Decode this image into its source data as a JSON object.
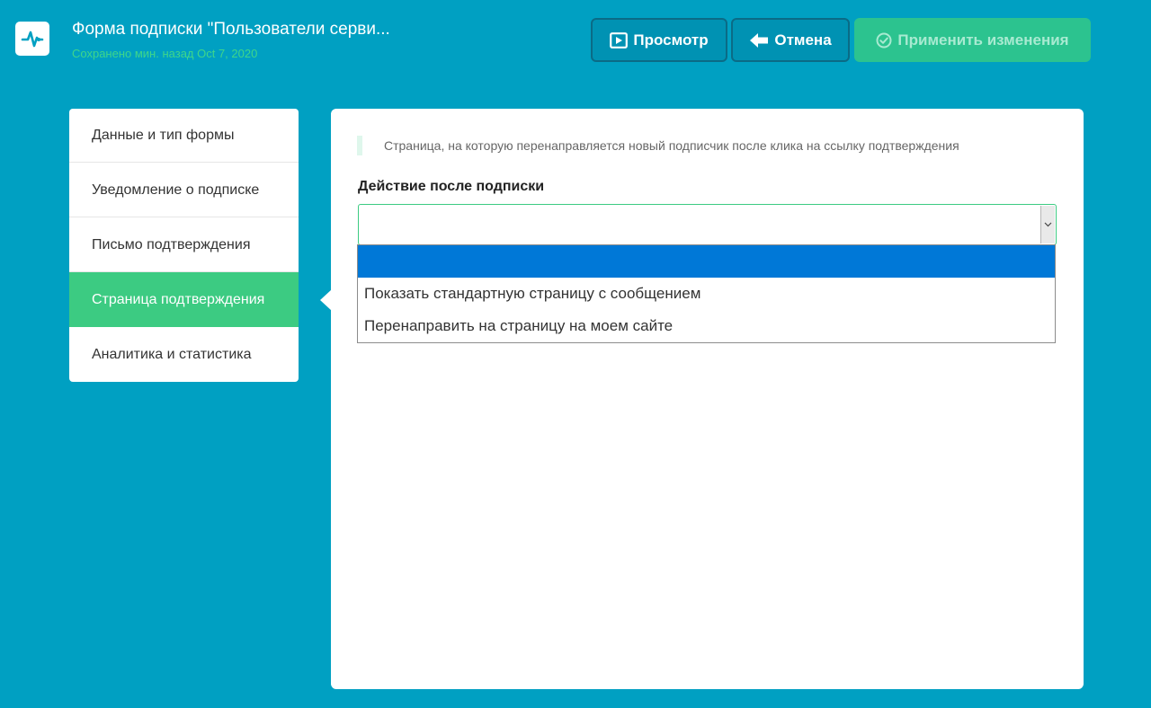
{
  "header": {
    "title": "Форма подписки \"Пользователи серви...",
    "saved_status": "Сохранено мин. назад Oct 7, 2020",
    "logo_icon": "pulse-icon"
  },
  "toolbar": {
    "preview_label": "Просмотр",
    "preview_icon": "play-square-icon",
    "cancel_label": "Отмена",
    "cancel_icon": "arrow-left-icon",
    "apply_label": "Применить изменения",
    "apply_icon": "check-circle-icon"
  },
  "sidebar": {
    "items": [
      {
        "label": "Данные и тип формы"
      },
      {
        "label": "Уведомление о подписке"
      },
      {
        "label": "Письмо подтверждения"
      },
      {
        "label": "Страница подтверждения",
        "active": true
      },
      {
        "label": "Аналитика и статистика"
      }
    ]
  },
  "main": {
    "hint": "Страница, на которую перенаправляется новый подписчик после клика на ссылку подтверждения",
    "field_label": "Действие после подписки",
    "select_value": "",
    "options": [
      {
        "label": ""
      },
      {
        "label": "Показать стандартную страницу с сообщением"
      },
      {
        "label": "Перенаправить на страницу на моем сайте"
      }
    ]
  },
  "colors": {
    "background": "#00a0c2",
    "accent_green": "#3ccb82",
    "apply_button": "#2cc38f",
    "highlight_blue": "#0078d7"
  }
}
